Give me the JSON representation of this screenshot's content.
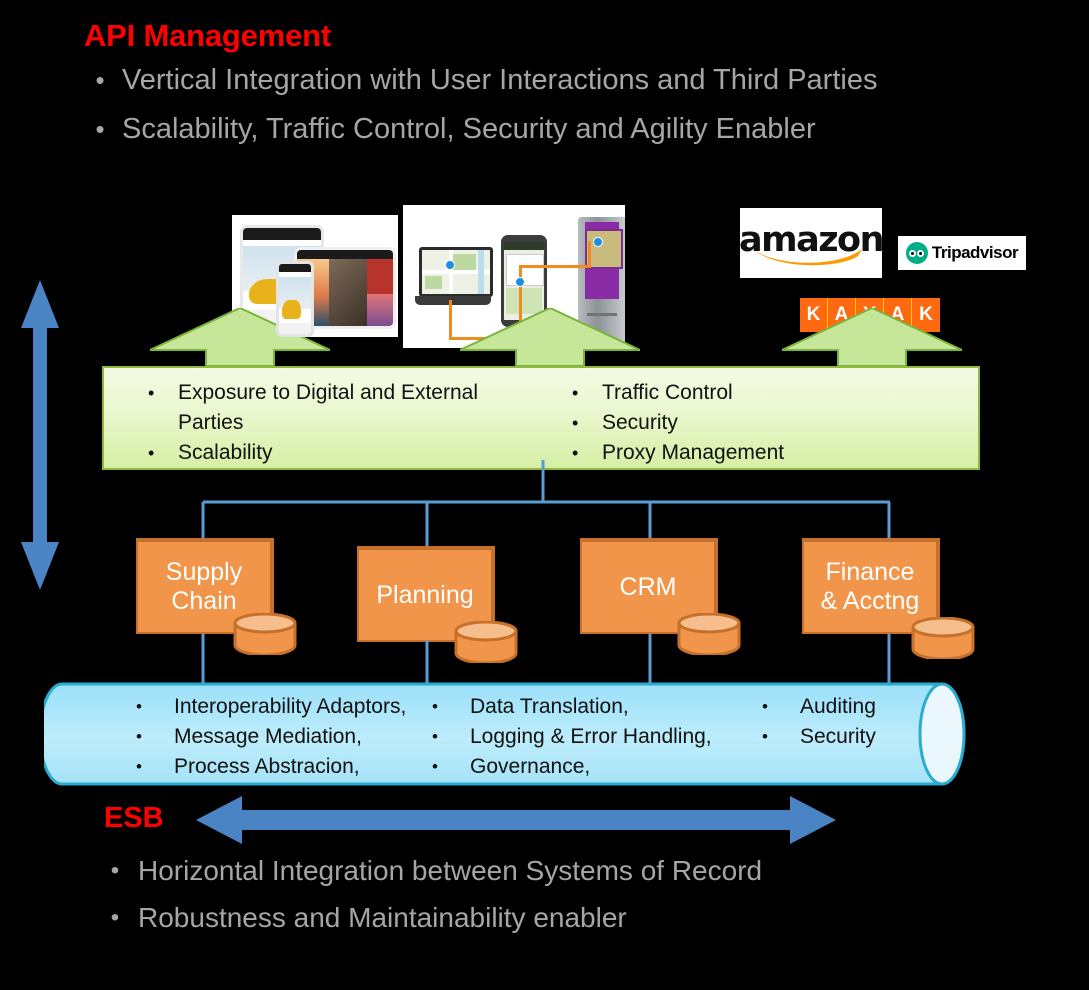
{
  "top": {
    "title": "API Management",
    "bullets": [
      "Vertical Integration with User Interactions and Third Parties",
      "Scalability, Traffic Control, Security and Agility Enabler"
    ],
    "bullet_glyph": "•"
  },
  "bottom": {
    "label": "ESB",
    "bullets": [
      "Horizontal Integration between Systems of Record",
      "Robustness and Maintainability enabler"
    ],
    "bullet_glyph": "•"
  },
  "channels": {
    "devices_photo": "tablets-and-smartphone-photo",
    "kiosk_photo": "laptop-smartphone-kiosk-photo",
    "logos": [
      {
        "name": "amazon",
        "text": "amazon"
      },
      {
        "name": "tripadvisor",
        "text": "Tripadvisor"
      },
      {
        "name": "kayak",
        "letters": [
          "K",
          "A",
          "Y",
          "A",
          "K"
        ]
      }
    ],
    "arrows": [
      "up-arrow-1",
      "up-arrow-2",
      "up-arrow-3"
    ]
  },
  "api_band": {
    "left_items": [
      "Exposure to Digital and External Parties",
      "Scalability"
    ],
    "right_items": [
      "Traffic Control",
      "Security",
      "Proxy Management"
    ],
    "bullet_glyph": "•"
  },
  "systems": [
    {
      "name": "supply-chain",
      "label": "Supply\nChain",
      "label_line1": "Supply",
      "label_line2": "Chain"
    },
    {
      "name": "planning",
      "label": "Planning",
      "label_line1": "Planning",
      "label_line2": ""
    },
    {
      "name": "crm",
      "label": "CRM",
      "label_line1": "CRM",
      "label_line2": ""
    },
    {
      "name": "finance",
      "label": "Finance & Acctng",
      "label_line1": "Finance",
      "label_line2": "& Acctng"
    }
  ],
  "esb": {
    "col1": [
      "Interoperability Adaptors,",
      "Message Mediation,",
      "Process Abstracion,"
    ],
    "col2": [
      "Data Translation,",
      "Logging & Error Handling,",
      "Governance,"
    ],
    "col3": [
      "Auditing",
      "Security"
    ],
    "bullet_glyph": "•"
  },
  "colors": {
    "title_red": "#FF0000",
    "body_gray": "#A6A6A6",
    "api_green": "#D6EFA4",
    "api_green_border": "#90B83C",
    "arrow_green": "#C6E79A",
    "system_orange": "#F0954A",
    "system_orange_border": "#C5712C",
    "esb_blue": "#A8E4F8",
    "esb_blue_border": "#2BACCF",
    "connector_blue": "#5B9BD5",
    "kayak_orange": "#FF690F",
    "amazon_smile": "#FF9900",
    "tripadvisor_green": "#00AF87",
    "background": "#000000"
  }
}
